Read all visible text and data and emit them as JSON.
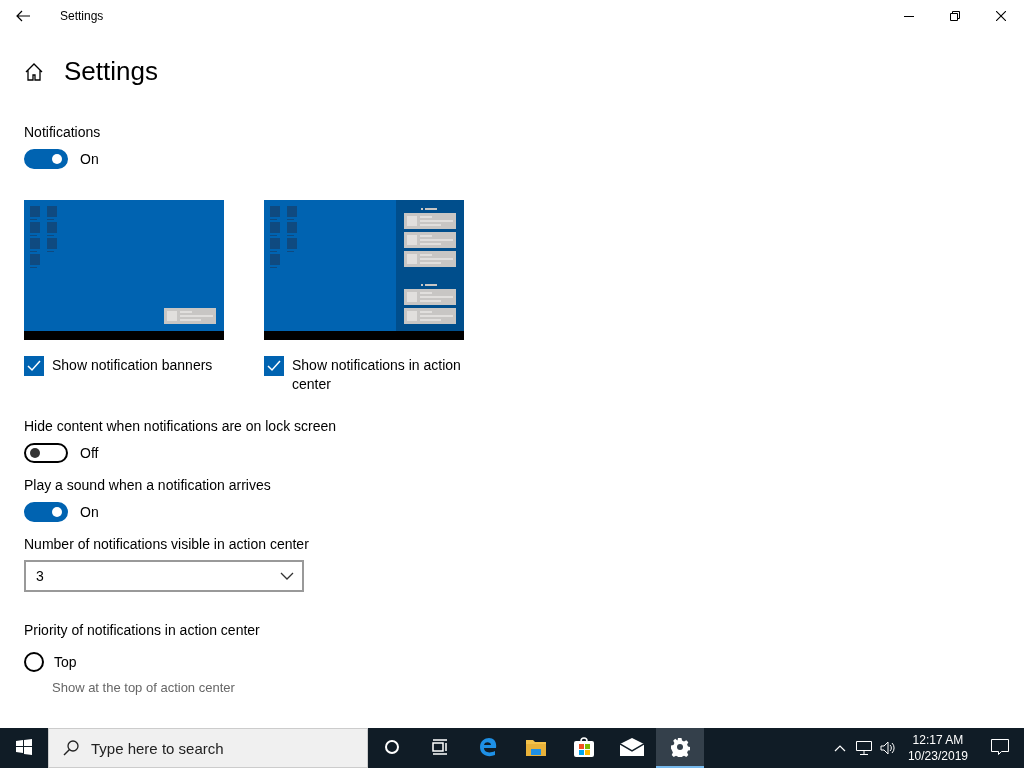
{
  "window": {
    "title": "Settings"
  },
  "page": {
    "title": "Settings"
  },
  "notifications": {
    "label": "Notifications",
    "on": true,
    "state_text": "On"
  },
  "previews": [
    {
      "kind": "banner",
      "label": "Show notification banners",
      "checked": true
    },
    {
      "kind": "action_center",
      "label": "Show notifications in action center",
      "checked": true
    }
  ],
  "settings": [
    {
      "kind": "toggle",
      "label": "Hide content when notifications are on lock screen",
      "on": false,
      "state_text": "Off"
    },
    {
      "kind": "toggle",
      "label": "Play a sound when a notification arrives",
      "on": true,
      "state_text": "On"
    },
    {
      "kind": "dropdown",
      "label": "Number of notifications visible in action center",
      "value": "3"
    }
  ],
  "priority": {
    "label": "Priority of notifications in action center",
    "options": [
      {
        "label": "Top",
        "description": "Show at the top of action center",
        "selected": false
      }
    ]
  },
  "taskbar": {
    "search_placeholder": "Type here to search",
    "apps": [
      {
        "kind": "cortana",
        "selected": false
      },
      {
        "kind": "taskview",
        "selected": false
      },
      {
        "kind": "edge",
        "selected": false
      },
      {
        "kind": "explorer",
        "selected": false
      },
      {
        "kind": "store",
        "selected": false
      },
      {
        "kind": "mail",
        "selected": false
      },
      {
        "kind": "settings",
        "selected": true
      }
    ],
    "time": "12:17 AM",
    "date": "10/23/2019"
  }
}
